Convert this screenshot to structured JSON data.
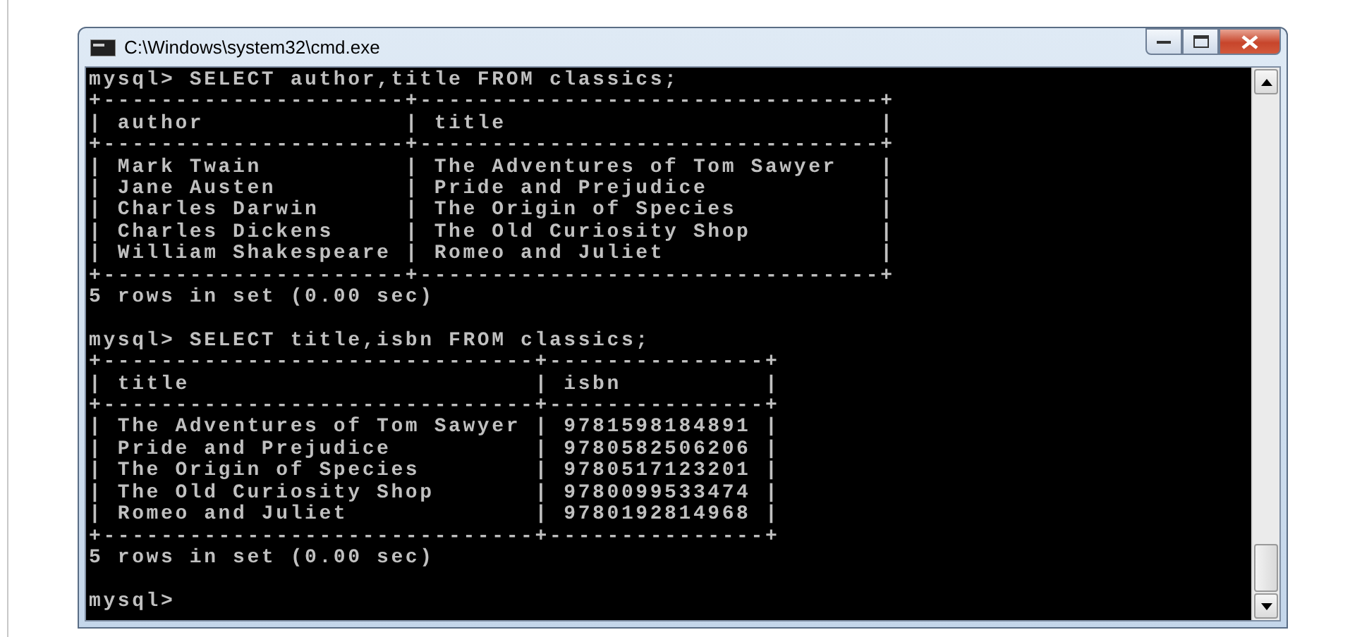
{
  "window": {
    "title": "C:\\Windows\\system32\\cmd.exe"
  },
  "console": {
    "blocks": [
      [
        "mysql> SELECT author,title FROM classics;",
        "+---------------------+--------------------------------+",
        "| author              | title                          |",
        "+---------------------+--------------------------------+",
        "| Mark Twain          | The Adventures of Tom Sawyer   |",
        "| Jane Austen         | Pride and Prejudice            |",
        "| Charles Darwin      | The Origin of Species          |",
        "| Charles Dickens     | The Old Curiosity Shop         |",
        "| William Shakespeare | Romeo and Juliet               |",
        "+---------------------+--------------------------------+",
        "5 rows in set (0.00 sec)"
      ],
      [
        "mysql> SELECT title,isbn FROM classics;",
        "+------------------------------+---------------+",
        "| title                        | isbn          |",
        "+------------------------------+---------------+",
        "| The Adventures of Tom Sawyer | 9781598184891 |",
        "| Pride and Prejudice          | 9780582506206 |",
        "| The Origin of Species        | 9780517123201 |",
        "| The Old Curiosity Shop       | 9780099533474 |",
        "| Romeo and Juliet             | 9780192814968 |",
        "+------------------------------+---------------+",
        "5 rows in set (0.00 sec)"
      ],
      [
        "mysql>"
      ]
    ]
  }
}
